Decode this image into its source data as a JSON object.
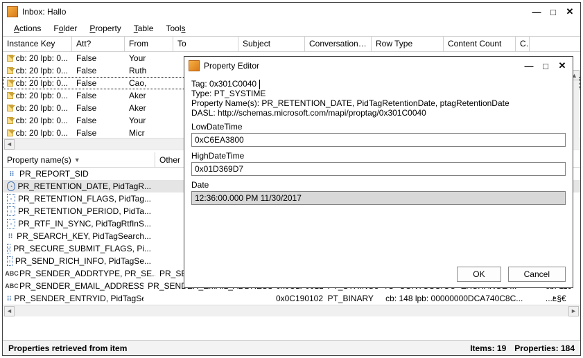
{
  "main": {
    "title": "Inbox: Hallo",
    "menu": {
      "actions": "Actions",
      "folder": "Folder",
      "property": "Property",
      "table": "Table",
      "tools": "Tools"
    },
    "columns": {
      "instance_key": "Instance Key",
      "att": "Att?",
      "from": "From",
      "to": "To",
      "subject": "Subject",
      "conversation_id": "Conversation ID",
      "row_type": "Row Type",
      "content_count": "Content Count",
      "cx": "C"
    },
    "rows": [
      {
        "ik": "cb: 20 lpb: 0...",
        "att": "False",
        "from": "Your"
      },
      {
        "ik": "cb: 20 lpb: 0...",
        "att": "False",
        "from": "Ruth"
      },
      {
        "ik": "cb: 20 lpb: 0...",
        "att": "False",
        "from": "Cao,"
      },
      {
        "ik": "cb: 20 lpb: 0...",
        "att": "False",
        "from": "Aker"
      },
      {
        "ik": "cb: 20 lpb: 0...",
        "att": "False",
        "from": "Aker"
      },
      {
        "ik": "cb: 20 lpb: 0...",
        "att": "False",
        "from": "Your"
      },
      {
        "ik": "cb: 20 lpb: 0...",
        "att": "False",
        "from": "Micr"
      }
    ],
    "props_header": {
      "name": "Property name(s)",
      "other": "Other"
    },
    "props": [
      {
        "icon": "bin",
        "name": "PR_REPORT_SID"
      },
      {
        "icon": "clock",
        "name": "PR_RETENTION_DATE, PidTagR..."
      },
      {
        "icon": "flags",
        "name": "PR_RETENTION_FLAGS, PidTag..."
      },
      {
        "icon": "flags",
        "name": "PR_RETENTION_PERIOD, PidTa..."
      },
      {
        "icon": "flags",
        "name": "PR_RTF_IN_SYNC, PidTagRtfInS..."
      },
      {
        "icon": "bin",
        "name": "PR_SEARCH_KEY, PidTagSearch..."
      },
      {
        "icon": "flags",
        "name": "PR_SECURE_SUBMIT_FLAGS, Pi..."
      },
      {
        "icon": "flags",
        "name": "PR_SEND_RICH_INFO, PidTagSe..."
      },
      {
        "icon": "abc",
        "name": "PR_SENDER_ADDRTYPE, PR_SE...",
        "other": "PR_SE..."
      },
      {
        "icon": "abc",
        "name": "PR_SENDER_EMAIL_ADDRESS, P...",
        "other": "PR_SENDER_EMAIL_ADDRESS_W, ...",
        "tag": "0x0C1F001E",
        "type": "PT_STRING8",
        "val": "/O=CONTOSO/OU=EXCHANGE ...",
        "alt": "cb: 119"
      },
      {
        "icon": "bin",
        "name": "PR_SENDER_ENTRYID, PidTagSe...",
        "other": "",
        "tag": "0x0C190102",
        "type": "PT_BINARY",
        "val": "cb: 148 lpb: 00000000DCA740C8C...",
        "alt": "...ܧ§€"
      }
    ],
    "status": {
      "left": "Properties retrieved from item",
      "items_label": "Items:",
      "items": "19",
      "props_label": "Properties:",
      "props": "184"
    }
  },
  "dialog": {
    "title": "Property Editor",
    "tag_label": "Tag:",
    "tag": "0x301C0040",
    "type_label": "Type:",
    "type": "PT_SYSTIME",
    "propnames_label": "Property Name(s):",
    "propnames": "PR_RETENTION_DATE, PidTagRetentionDate, ptagRetentionDate",
    "dasl_label": "DASL:",
    "dasl": "http://schemas.microsoft.com/mapi/proptag/0x301C0040",
    "low_label": "LowDateTime",
    "low": "0xC6EA3800",
    "high_label": "HighDateTime",
    "high": "0x01D369D7",
    "date_label": "Date",
    "date": "12:36:00.000 PM 11/30/2017",
    "ok": "OK",
    "cancel": "Cancel"
  }
}
